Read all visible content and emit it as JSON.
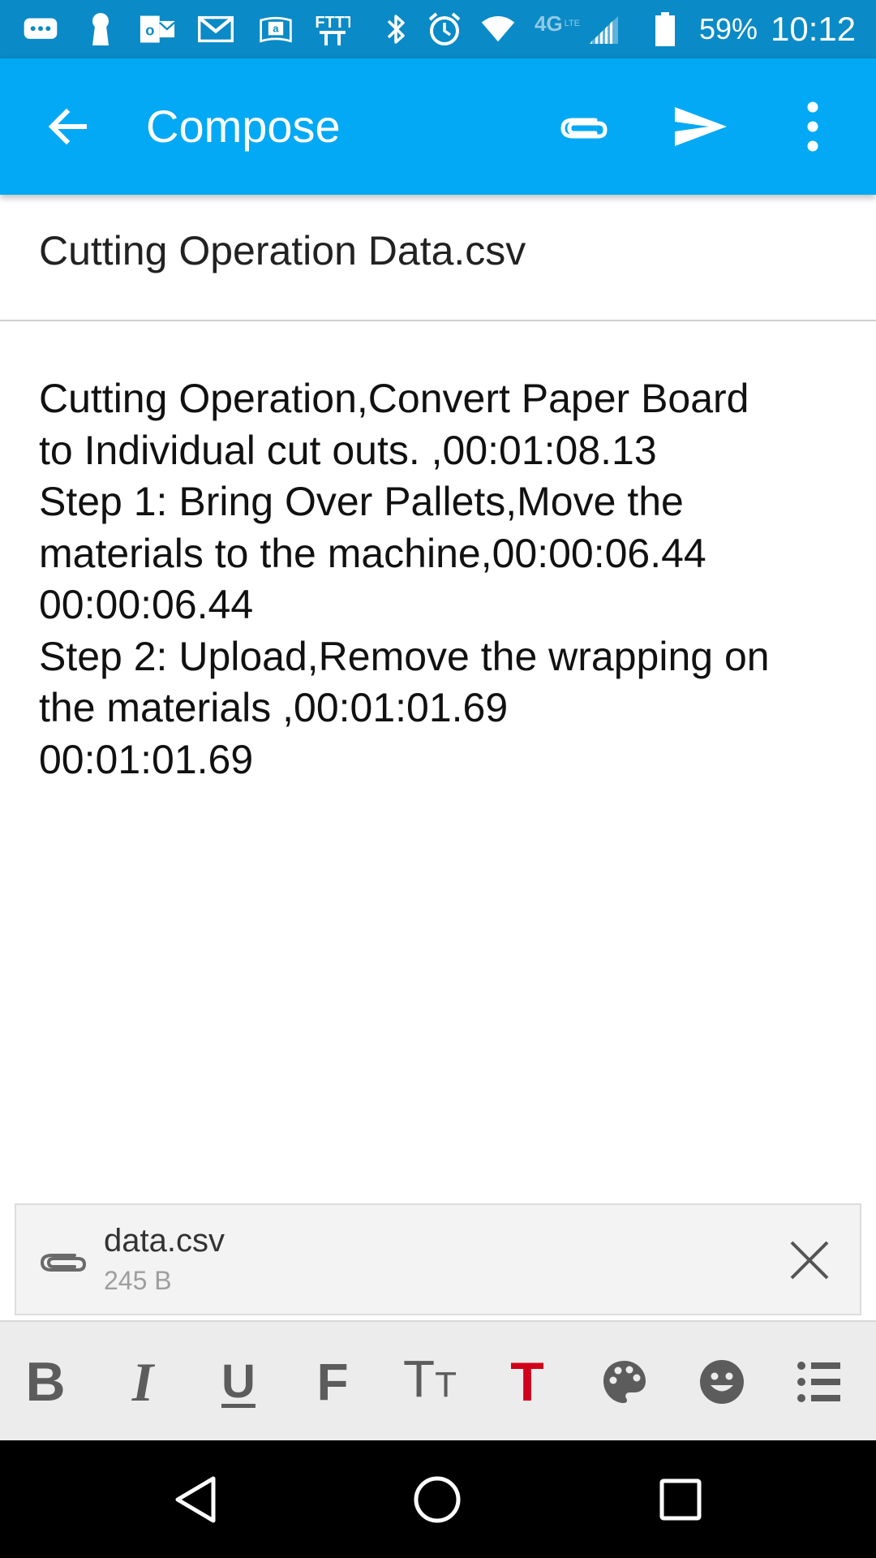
{
  "status_bar": {
    "battery_percent": "59%",
    "time": "10:12",
    "network": "4G",
    "network_sub": "LTE",
    "icons": [
      "messaging-icon",
      "keyhole-icon",
      "outlook-icon",
      "gmail-icon",
      "amazon-kindle-icon",
      "ifttt-icon",
      "bluetooth-icon",
      "alarm-icon",
      "wifi-icon",
      "network-4g-lte-icon",
      "signal-icon",
      "battery-icon"
    ],
    "ifttt_text": "IFTTT"
  },
  "app_bar": {
    "title": "Compose",
    "color": "#03a9f4",
    "icons": [
      "back-arrow-icon",
      "attach-icon",
      "send-icon",
      "more-vert-icon"
    ]
  },
  "compose": {
    "subject": "Cutting Operation Data.csv",
    "body_lines": [
      "Cutting Operation,Convert Paper Board",
      "to Individual cut outs. ,00:01:08.13",
      "Step 1: Bring Over Pallets,Move the",
      "materials to the machine,00:00:06.44",
      "00:00:06.44",
      "Step 2: Upload,Remove the wrapping on",
      "the materials ,00:01:01.69",
      "00:01:01.69"
    ]
  },
  "attachment": {
    "file_name": "data.csv",
    "file_size": "245 B",
    "icons": [
      "paperclip-icon",
      "close-icon"
    ]
  },
  "format_toolbar": {
    "bold": "B",
    "italic": "I",
    "underline": "U",
    "font": "F",
    "text_size_big": "T",
    "text_size_small": "T",
    "text_color": "T",
    "text_color_value": "#d0021b",
    "icons": [
      "palette-icon",
      "emoji-icon",
      "bulleted-list-icon"
    ]
  },
  "nav_bar": {
    "icons": [
      "nav-back-icon",
      "nav-home-icon",
      "nav-recents-icon"
    ]
  }
}
